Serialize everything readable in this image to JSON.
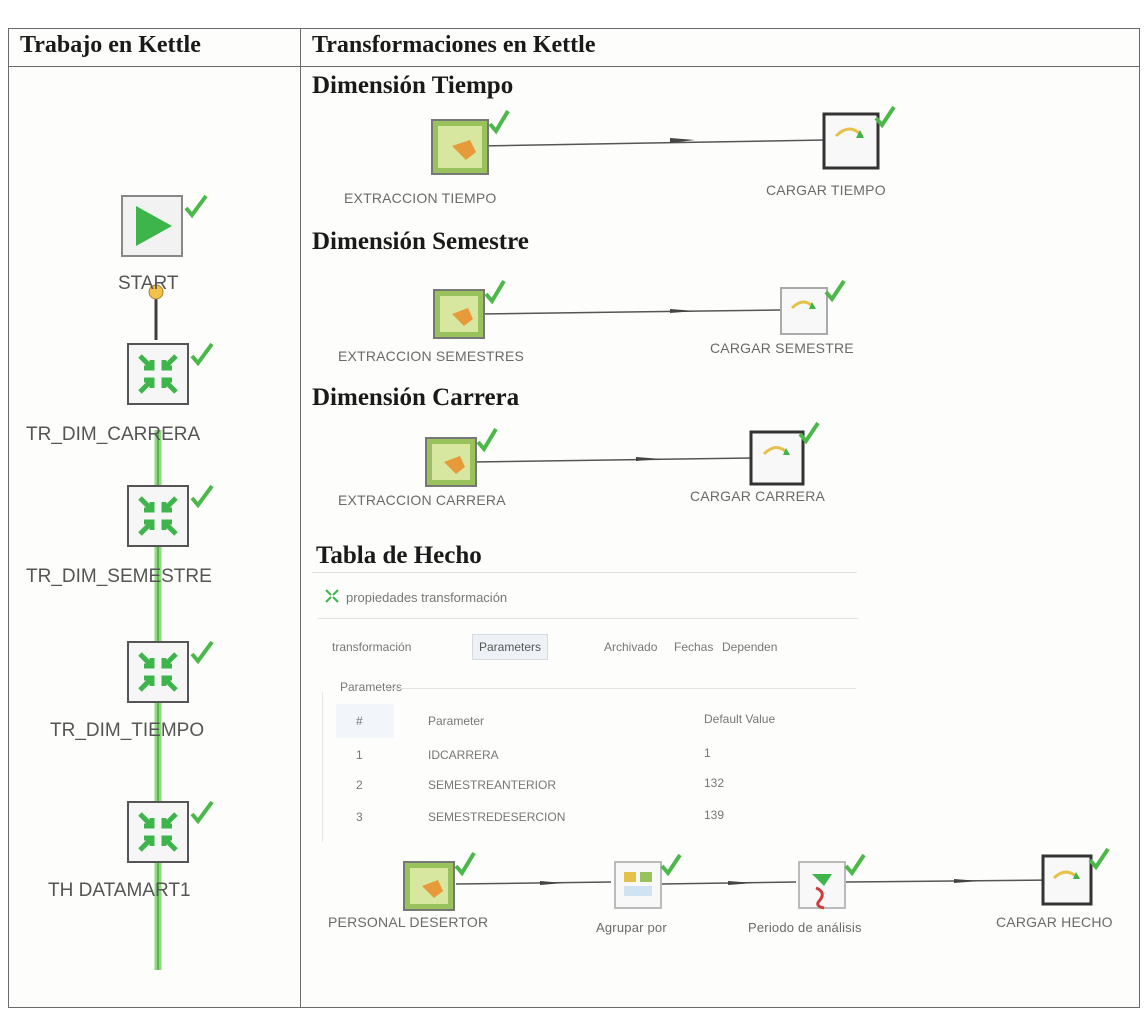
{
  "columns": {
    "job": "Trabajo en Kettle",
    "transformations": "Transformaciones en Kettle"
  },
  "job_steps": {
    "start": "START",
    "step1": "TR_DIM_CARRERA",
    "step2": "TR_DIM_SEMESTRE",
    "step3": "TR_DIM_TIEMPO",
    "step4": "TH DATAMART1"
  },
  "sections": {
    "tiempo": {
      "title": "Dimensión Tiempo",
      "source": "EXTRACCION TIEMPO",
      "target": "CARGAR TIEMPO"
    },
    "semestre": {
      "title": "Dimensión Semestre",
      "source": "EXTRACCION SEMESTRES",
      "target": "CARGAR SEMESTRE"
    },
    "carrera": {
      "title": "Dimensión Carrera",
      "source": "EXTRACCION CARRERA",
      "target": "CARGAR CARRERA"
    },
    "hecho": {
      "title": "Tabla de Hecho",
      "dialog": {
        "title": "propiedades transformación",
        "tabs": [
          "transformación",
          "Parameters",
          "Archivado",
          "Fechas",
          "Dependen"
        ],
        "group_label": "Parameters",
        "headers": [
          "#",
          "Parameter",
          "Default Value"
        ],
        "rows": [
          [
            "1",
            "IDCARRERA",
            "1"
          ],
          [
            "2",
            "SEMESTREANTERIOR",
            "132"
          ],
          [
            "3",
            "SEMESTREDESERCION",
            "139"
          ]
        ]
      },
      "steps": {
        "s1": "PERSONAL DESERTOR",
        "s2": "Agrupar por",
        "s3": "Periodo de análisis",
        "s4": "CARGAR HECHO"
      }
    }
  },
  "colors": {
    "check": "#4db84a",
    "hop_green": "#7ad46a",
    "arrow": "#555555"
  }
}
